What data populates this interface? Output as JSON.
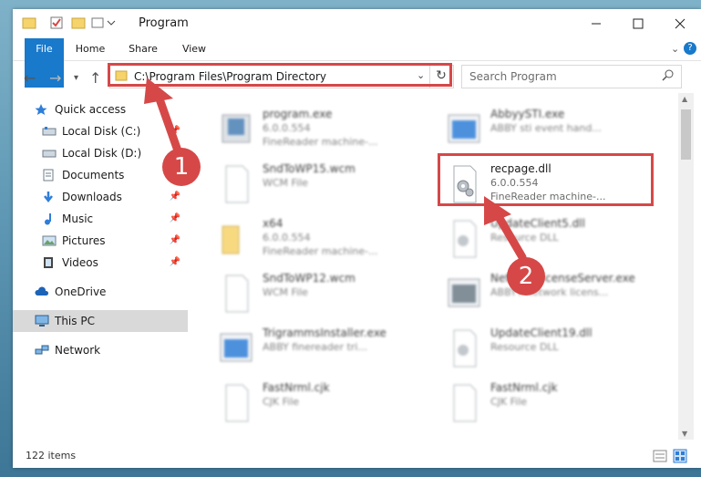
{
  "window": {
    "title": "Program"
  },
  "ribbon": {
    "tabs": [
      "File",
      "Home",
      "Share",
      "View"
    ]
  },
  "address_bar": {
    "path": "C:\\Program Files\\Program Directory"
  },
  "search": {
    "placeholder": "Search Program"
  },
  "sidebar": {
    "items": [
      {
        "label": "Quick access"
      },
      {
        "label": "Local Disk (C:)"
      },
      {
        "label": "Local Disk (D:)"
      },
      {
        "label": "Documents"
      },
      {
        "label": "Downloads"
      },
      {
        "label": "Music"
      },
      {
        "label": "Pictures"
      },
      {
        "label": "Videos"
      },
      {
        "label": "OneDrive"
      },
      {
        "label": "This PC"
      },
      {
        "label": "Network"
      }
    ]
  },
  "files": [
    {
      "name": "program.exe",
      "line2": "6.0.0.554",
      "line3": "FineReader machine-..."
    },
    {
      "name": "AbbyySTI.exe",
      "line2": "ABBY sti event hand...",
      "line3": ""
    },
    {
      "name": "SndToWP15.wcm",
      "line2": "WCM File",
      "line3": ""
    },
    {
      "name": "recpage.dll",
      "line2": "6.0.0.554",
      "line3": "FineReader machine-..."
    },
    {
      "name": "x64",
      "line2": "6.0.0.554",
      "line3": "FineReader machine-..."
    },
    {
      "name": "UpdateClient5.dll",
      "line2": "Resource DLL",
      "line3": ""
    },
    {
      "name": "SndToWP12.wcm",
      "line2": "WCM File",
      "line3": ""
    },
    {
      "name": "NetworkLicenseServer.exe",
      "line2": "ABBYY network licens...",
      "line3": ""
    },
    {
      "name": "TrigrammsInstaller.exe",
      "line2": "ABBY finereader tri...",
      "line3": ""
    },
    {
      "name": "UpdateClient19.dll",
      "line2": "Resource DLL",
      "line3": ""
    },
    {
      "name": "FastNrml.cjk",
      "line2": "CJK File",
      "line3": ""
    },
    {
      "name": "FastNrml.cjk",
      "line2": "CJK File",
      "line3": ""
    }
  ],
  "status": {
    "item_count": "122 items"
  },
  "markers": [
    "1",
    "2"
  ],
  "colors": {
    "accent": "#1979ca",
    "highlight": "#d64848"
  }
}
